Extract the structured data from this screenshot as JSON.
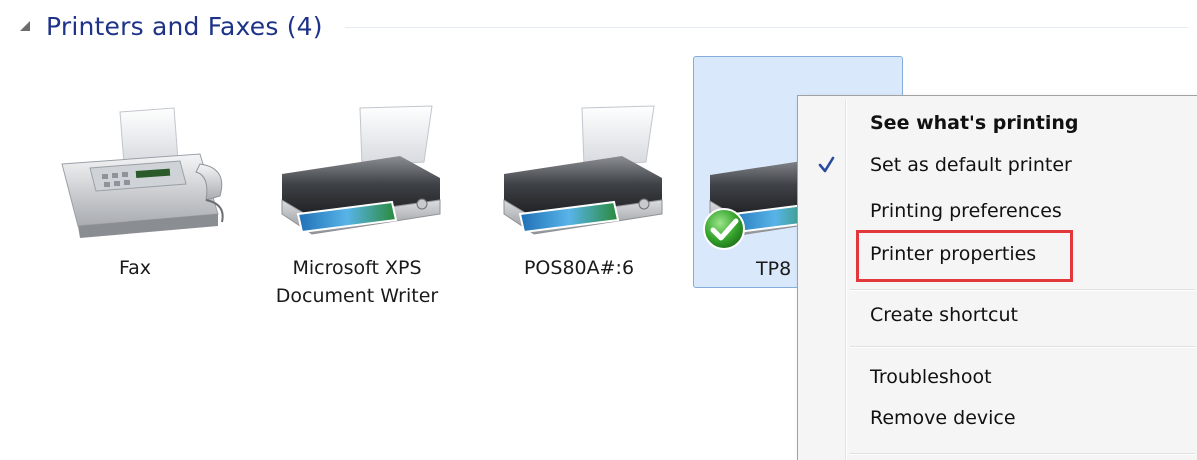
{
  "group": {
    "title": "Printers and Faxes (4)"
  },
  "devices": [
    {
      "label": "Fax",
      "icon": "fax-icon"
    },
    {
      "label_line1": "Microsoft XPS",
      "label_line2": "Document Writer",
      "icon": "printer-icon"
    },
    {
      "label": "POS80A#:6",
      "icon": "printer-icon"
    },
    {
      "label": "TP8",
      "icon": "printer-icon",
      "selected": true,
      "badge": "default-checkmark-icon"
    }
  ],
  "context_menu": {
    "items": [
      {
        "label": "See what's printing",
        "bold": true
      },
      {
        "label": "Set as default printer",
        "checked": true
      },
      {
        "label": "Printing preferences"
      },
      {
        "label": "Printer properties",
        "highlighted": true
      },
      {
        "label": "Create shortcut"
      },
      {
        "label": "Troubleshoot"
      },
      {
        "label": "Remove device"
      }
    ]
  },
  "colors": {
    "group_title": "#1e3287",
    "selection_bg": "#d9e8fb",
    "selection_border": "#84acdd",
    "highlight_box": "#e2373b",
    "check": "#2a4aa0"
  }
}
